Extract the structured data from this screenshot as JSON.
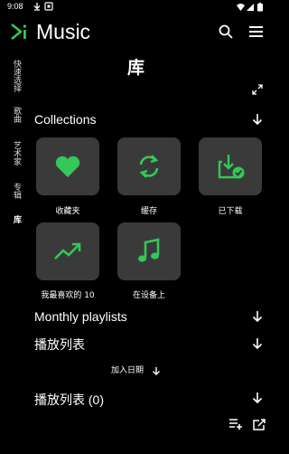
{
  "status_bar": {
    "time": "9:08"
  },
  "app": {
    "title": "Music"
  },
  "sidebar": {
    "items": [
      {
        "label": "快速选择"
      },
      {
        "label": "歌曲"
      },
      {
        "label": "艺术家"
      },
      {
        "label": "专辑"
      },
      {
        "label": "库"
      }
    ]
  },
  "page": {
    "title": "库"
  },
  "collections": {
    "header": "Collections",
    "tiles": [
      {
        "label": "收藏夹",
        "icon": "heart-icon"
      },
      {
        "label": "缓存",
        "icon": "sync-icon"
      },
      {
        "label": "已下载",
        "icon": "download-icon"
      },
      {
        "label": "我最喜欢的 10",
        "icon": "trending-up-icon"
      },
      {
        "label": "在设备上",
        "icon": "music-note-icon"
      }
    ]
  },
  "monthly": {
    "header": "Monthly playlists"
  },
  "playlists": {
    "header": "播放列表",
    "sort_label": "加入日期"
  },
  "playlists_count": {
    "header": "播放列表 (0)"
  },
  "colors": {
    "accent": "#34c759",
    "tile_bg": "#3a3a3a",
    "background": "#000000"
  }
}
